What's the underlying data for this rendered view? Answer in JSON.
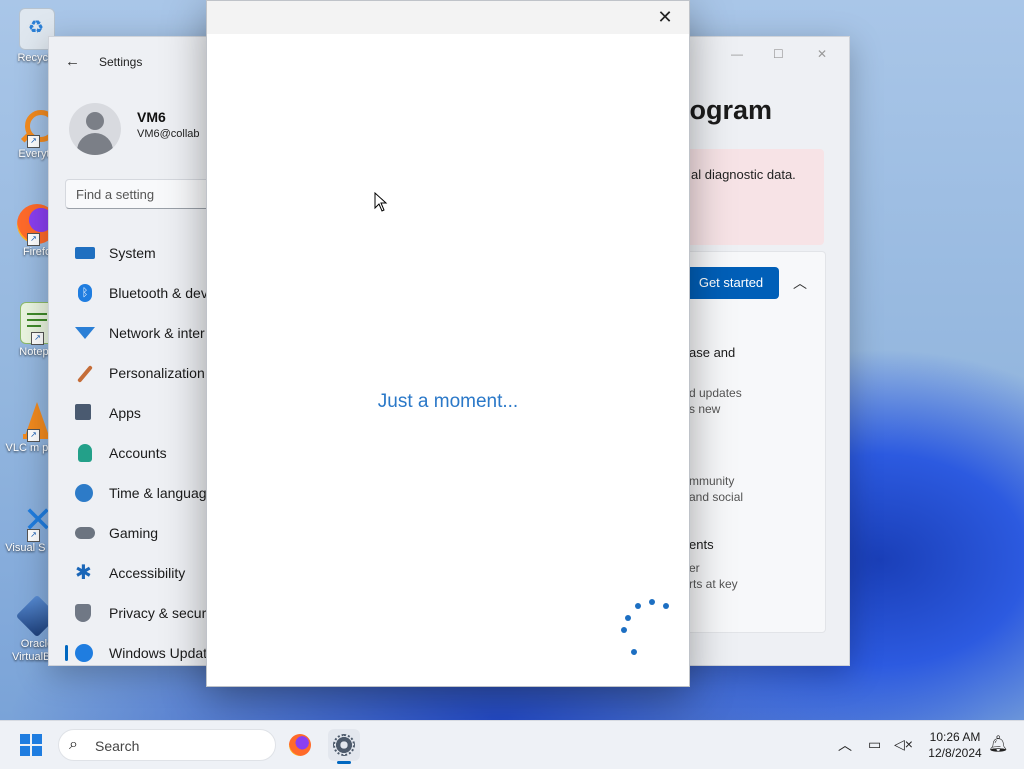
{
  "desktop": {
    "icons": [
      {
        "label": "Recycle",
        "icon": "recycle-bin-icon"
      },
      {
        "label": "Everyth",
        "icon": "everything-search-icon"
      },
      {
        "label": "Firefo",
        "icon": "firefox-icon"
      },
      {
        "label": "Notepa",
        "icon": "notepad-icon"
      },
      {
        "label": "VLC m playe",
        "icon": "vlc-icon"
      },
      {
        "label": "Visual S Cod",
        "icon": "vscode-icon"
      },
      {
        "label": "Oracle VirtualBox",
        "icon": "virtualbox-icon"
      }
    ]
  },
  "settings": {
    "title": "Settings",
    "user": {
      "name": "VM6",
      "email": "VM6@collab"
    },
    "search_placeholder": "Find a setting",
    "nav": [
      {
        "label": "System",
        "icon": "system-icon",
        "color": "#1f6fc0"
      },
      {
        "label": "Bluetooth & dev",
        "icon": "bluetooth-icon",
        "color": "#1f7de0"
      },
      {
        "label": "Network & inter",
        "icon": "wifi-icon",
        "color": "#2a7fd6"
      },
      {
        "label": "Personalization",
        "icon": "brush-icon",
        "color": "#c56d38"
      },
      {
        "label": "Apps",
        "icon": "apps-icon",
        "color": "#4a5a70"
      },
      {
        "label": "Accounts",
        "icon": "accounts-icon",
        "color": "#23a089"
      },
      {
        "label": "Time & languag",
        "icon": "time-language-icon",
        "color": "#2d7bc8"
      },
      {
        "label": "Gaming",
        "icon": "gaming-icon",
        "color": "#6c7480"
      },
      {
        "label": "Accessibility",
        "icon": "accessibility-icon",
        "color": "#1a66b8"
      },
      {
        "label": "Privacy & securi",
        "icon": "shield-icon",
        "color": "#707885"
      },
      {
        "label": "Windows Updat",
        "icon": "windows-update-icon",
        "color": "#1f7de0",
        "active": true
      }
    ],
    "page_title": "rogram",
    "warning_text": "al diagnostic data.",
    "get_started_label": "Get started",
    "card_items": [
      {
        "head": "ase and",
        "line1": "d updates",
        "line2": "s new"
      },
      {
        "head": "",
        "line1": "mmunity",
        "line2": "and social"
      },
      {
        "head": "ents",
        "line1": "er",
        "line2": "rts at key"
      }
    ]
  },
  "dialog": {
    "loading_text": "Just a moment...",
    "close_label": "✕"
  },
  "taskbar": {
    "search_placeholder": "Search",
    "time": "10:26 AM",
    "date": "12/8/2024"
  }
}
